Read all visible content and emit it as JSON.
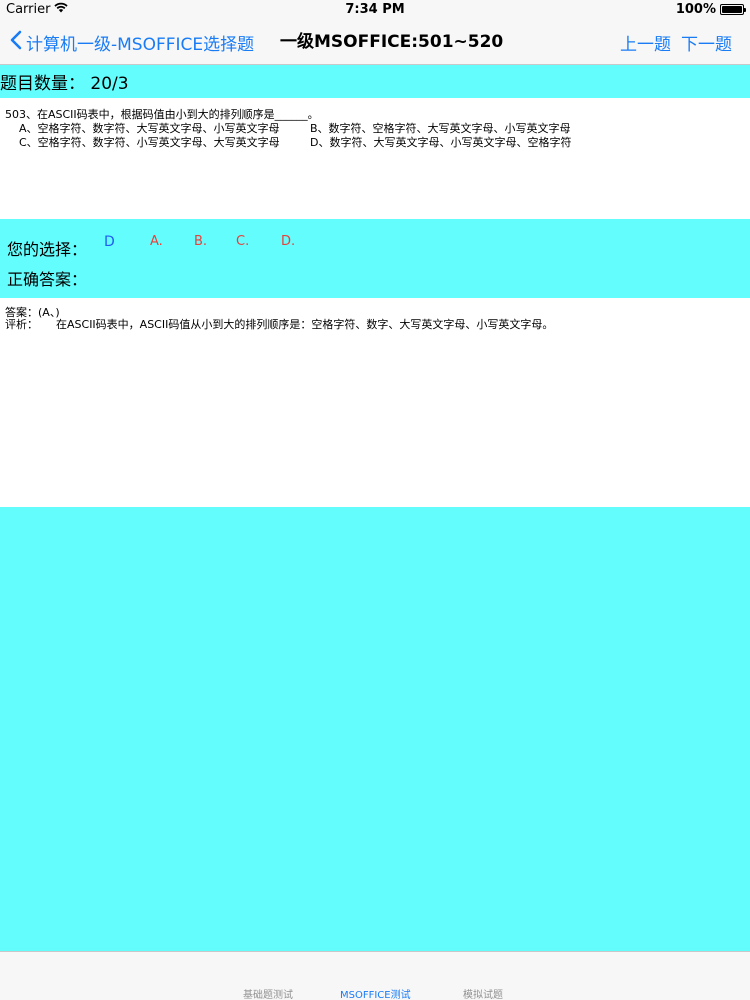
{
  "status": {
    "carrier": "Carrier",
    "time": "7:34 PM",
    "battery": "100%"
  },
  "nav": {
    "back_label": "计算机一级-MSOFFICE选择题",
    "title": "一级MSOFFICE:501~520",
    "prev_label": "上一题",
    "next_label": "下一题"
  },
  "count": {
    "text": "题目数量：  20/3"
  },
  "question": {
    "stem": "503、在ASCII码表中，根据码值由小到大的排列顺序是______。",
    "option_a": "A、空格字符、数字符、大写英文字母、小写英文字母",
    "option_b": "B、数字符、空格字符、大写英文字母、小写英文字母",
    "option_c": "C、空格字符、数字符、小写英文字母、大写英文字母",
    "option_d": "D、数字符、大写英文字母、小写英文字母、空格字符"
  },
  "choice": {
    "your_choice_label": "您的选择：",
    "correct_answer_label": "正确答案：",
    "selected": "D",
    "options": [
      "A.",
      "B.",
      "C.",
      "D."
    ],
    "selected_color": "#1f5ef0",
    "option_color": "#e8413a"
  },
  "explanation": {
    "answer_line": "答案：(A、)",
    "analysis_label": "评析：",
    "analysis_text": "在ASCII码表中，ASCII码值从小到大的排列顺序是：空格字符、数字、大写英文字母、小写英文字母。"
  },
  "tabs": [
    {
      "label": "基础题测试",
      "active": false
    },
    {
      "label": "MSOFFICE测试",
      "active": true
    },
    {
      "label": "模拟试题",
      "active": false
    }
  ],
  "colors": {
    "accent": "#1a7cf5",
    "cyan": "#64fdfd"
  }
}
